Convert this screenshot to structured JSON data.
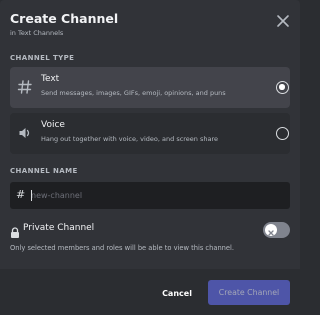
{
  "header": {
    "title": "Create Channel",
    "subtitle": "in Text Channels"
  },
  "channel_type": {
    "label": "CHANNEL TYPE",
    "options": [
      {
        "title": "Text",
        "description": "Send messages, images, GIFs, emoji, opinions, and puns",
        "icon": "hash-icon",
        "selected": true
      },
      {
        "title": "Voice",
        "description": "Hang out together with voice, video, and screen share",
        "icon": "speaker-icon",
        "selected": false
      }
    ]
  },
  "channel_name": {
    "label": "CHANNEL NAME",
    "prefix": "#",
    "value": "",
    "placeholder": "new-channel"
  },
  "private": {
    "label": "Private Channel",
    "icon": "lock-icon",
    "enabled": false,
    "description": "Only selected members and roles will be able to view this channel."
  },
  "footer": {
    "cancel_label": "Cancel",
    "create_label": "Create Channel"
  },
  "colors": {
    "modal_bg": "#313338",
    "footer_bg": "#2b2d31",
    "selected_option_bg": "#43444b",
    "input_bg": "#1e1f22",
    "primary_button": "#4e55a8",
    "toggle_off": "#80848e"
  }
}
